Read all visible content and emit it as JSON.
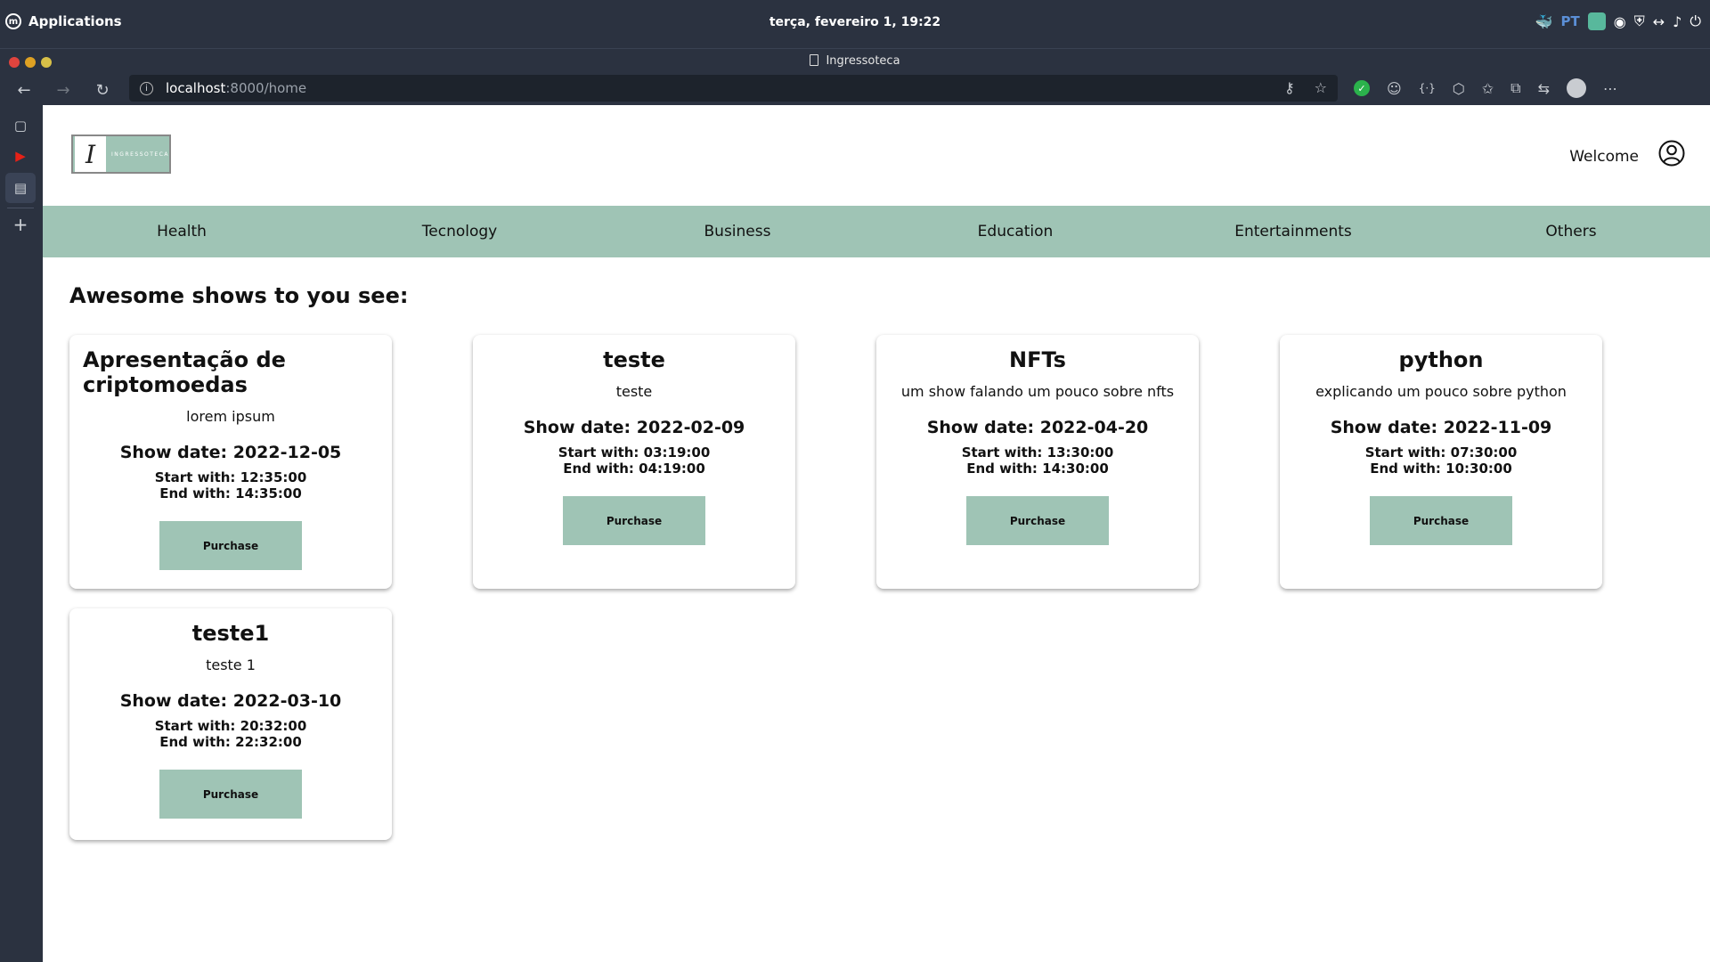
{
  "os": {
    "apps_label": "Applications",
    "clock": "terça, fevereiro  1, 19:22",
    "tray_lang": "PT"
  },
  "browser": {
    "tab_title": "Ingressoteca",
    "url_host": "localhost",
    "url_path": ":8000/home"
  },
  "site": {
    "logo_word": "INGRESSOTECA",
    "welcome": "Welcome",
    "categories": [
      "Health",
      "Tecnology",
      "Business",
      "Education",
      "Entertainments",
      "Others"
    ],
    "section_title": "Awesome shows to you see:",
    "purchase_label": "Purchase",
    "shows": [
      {
        "title": "Apresentação de criptomoedas",
        "desc": "lorem ipsum",
        "date": "Show date: 2022-12-05",
        "start": "Start with: 12:35:00",
        "end": "End with: 14:35:00"
      },
      {
        "title": "teste",
        "desc": "teste",
        "date": "Show date: 2022-02-09",
        "start": "Start with: 03:19:00",
        "end": "End with: 04:19:00"
      },
      {
        "title": "NFTs",
        "desc": "um show falando um pouco sobre nfts",
        "date": "Show date: 2022-04-20",
        "start": "Start with: 13:30:00",
        "end": "End with: 14:30:00"
      },
      {
        "title": "python",
        "desc": "explicando um pouco sobre python",
        "date": "Show date: 2022-11-09",
        "start": "Start with: 07:30:00",
        "end": "End with: 10:30:00"
      },
      {
        "title": "teste1",
        "desc": "teste 1",
        "date": "Show date: 2022-03-10",
        "start": "Start with: 20:32:00",
        "end": "End with: 22:32:00"
      }
    ]
  },
  "colors": {
    "accent": "#9fc4b5",
    "chrome": "#2b3240"
  }
}
